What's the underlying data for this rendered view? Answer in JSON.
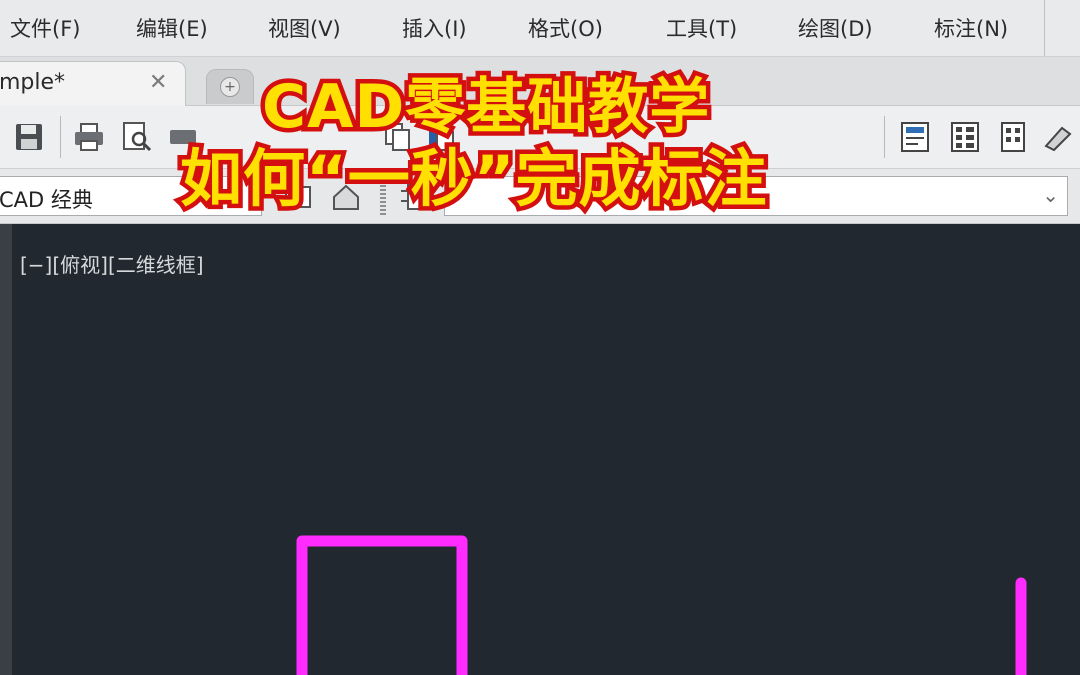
{
  "menu": {
    "items": [
      "文件(F)",
      "编辑(E)",
      "视图(V)",
      "插入(I)",
      "格式(O)",
      "工具(T)",
      "绘图(D)",
      "标注(N)"
    ]
  },
  "tabs": {
    "document_label": "mple*",
    "close_glyph": "✕"
  },
  "workspace": {
    "current": "CAD 经典",
    "dropdown_glyph": "⌄"
  },
  "viewport": {
    "label": "[−][俯视][二维线框]"
  },
  "overlay": {
    "line1": "CAD零基础教学",
    "line2": "如何“一秒”完成标注"
  },
  "colors": {
    "canvas_bg": "#212830",
    "geometry": "#ff2bff",
    "overlay_fill": "#ffe000",
    "overlay_stroke": "#d40f0f"
  },
  "icons": [
    "save-icon",
    "print-icon",
    "print-preview-icon",
    "publish-icon",
    "copy-icon",
    "paste-icon",
    "properties-icon",
    "design-center-icon",
    "tool-palette-icon",
    "sheet-set-icon",
    "markup-icon",
    "dimension-icon",
    "plus-icon"
  ]
}
